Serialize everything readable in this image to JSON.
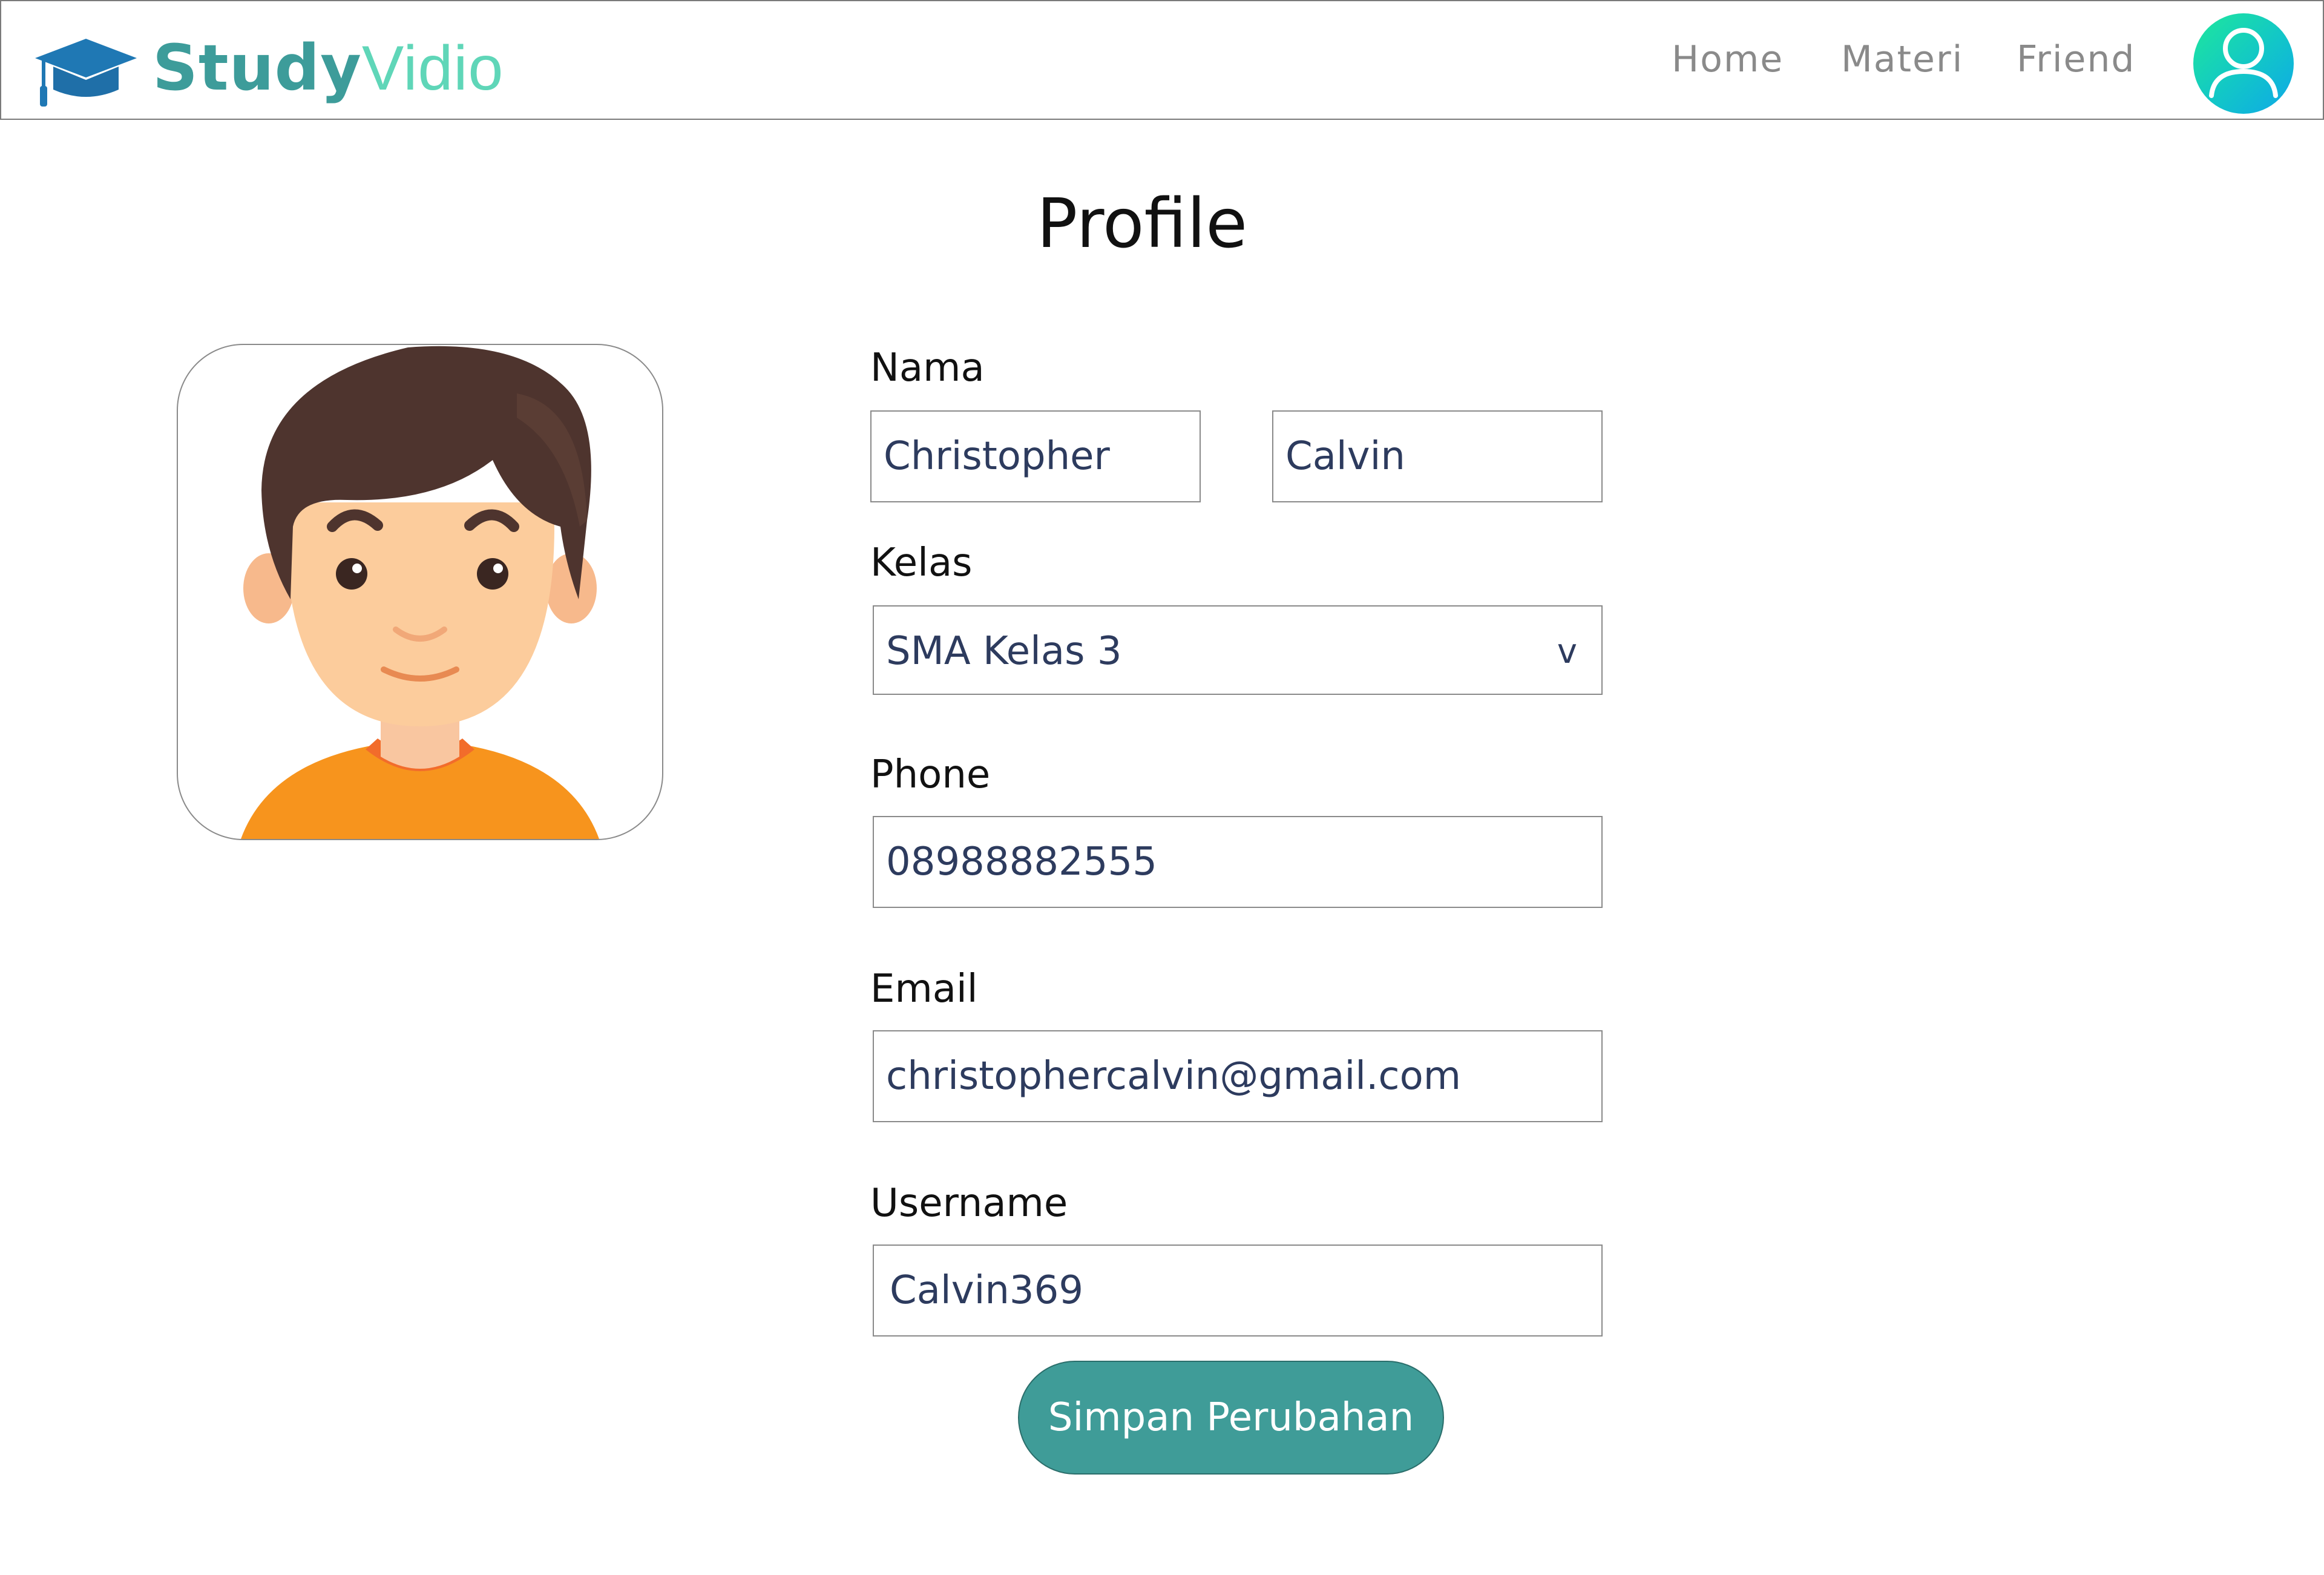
{
  "brand": {
    "name_part1": "Study",
    "name_part2": "Vidio",
    "logo_icon": "graduation-cap-icon",
    "colors": {
      "primary": "#3d9c9a",
      "secondary": "#5fd6b8",
      "cap": "#1f78b4"
    }
  },
  "nav": {
    "items": [
      {
        "label": "Home"
      },
      {
        "label": "Materi"
      },
      {
        "label": "Friend"
      }
    ],
    "account_icon": "user-avatar-icon"
  },
  "page": {
    "title": "Profile"
  },
  "profile": {
    "photo_icon": "boy-avatar-illustration"
  },
  "form": {
    "nama": {
      "label": "Nama",
      "first_name": "Christopher",
      "last_name": "Calvin"
    },
    "kelas": {
      "label": "Kelas",
      "value": "SMA Kelas 3",
      "caret": "v"
    },
    "phone": {
      "label": "Phone",
      "value": "08988882555"
    },
    "email": {
      "label": "Email",
      "value": "christophercalvin@gmail.com"
    },
    "username": {
      "label": "Username",
      "value": "Calvin369"
    },
    "submit": {
      "label": "Simpan Perubahan",
      "color": "#3f9c98"
    }
  }
}
